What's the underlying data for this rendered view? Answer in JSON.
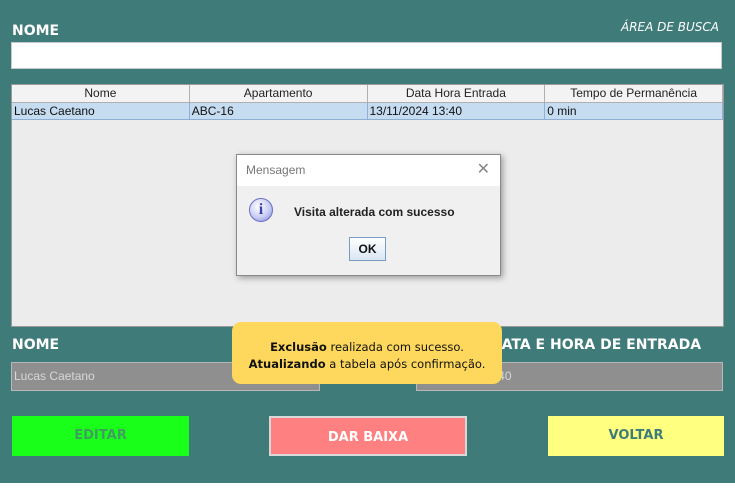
{
  "form": {
    "nome_label": "NOME",
    "area_busca": "ÁREA DE BUSCA",
    "search_value": ""
  },
  "table": {
    "columns": [
      "Nome",
      "Apartamento",
      "Data Hora Entrada",
      "Tempo de Permanência"
    ],
    "rows": [
      [
        "Lucas Caetano",
        "ABC-16",
        "13/11/2024 13:40",
        "0 min"
      ]
    ]
  },
  "dialog": {
    "title": "Mensagem",
    "close": "✕",
    "icon": "info-icon",
    "message": "Visita alterada com sucesso",
    "ok": "OK"
  },
  "details": {
    "nome_label": "NOME",
    "data_label": "DATA E HORA DE ENTRADA",
    "nome_value": "Lucas Caetano",
    "data_value": "13/11/2024 13:40"
  },
  "toast": {
    "line1_bold": "Exclusão",
    "line1_rest": " realizada com sucesso.",
    "line2_bold": "Atualizando",
    "line2_rest": " a tabela após confirmação."
  },
  "buttons": {
    "editar": "EDITAR",
    "dar_baixa": "DAR BAIXA",
    "voltar": "VOLTAR"
  },
  "colors": {
    "background": "#3f7b79",
    "editar_bg": "#1aff1a",
    "editar_text": "#3f9e5f",
    "dar_baixa_bg": "#ff8080",
    "voltar_bg": "#ffff80",
    "toast_bg": "#fdd85d",
    "selected_row": "#c6dcf1"
  }
}
